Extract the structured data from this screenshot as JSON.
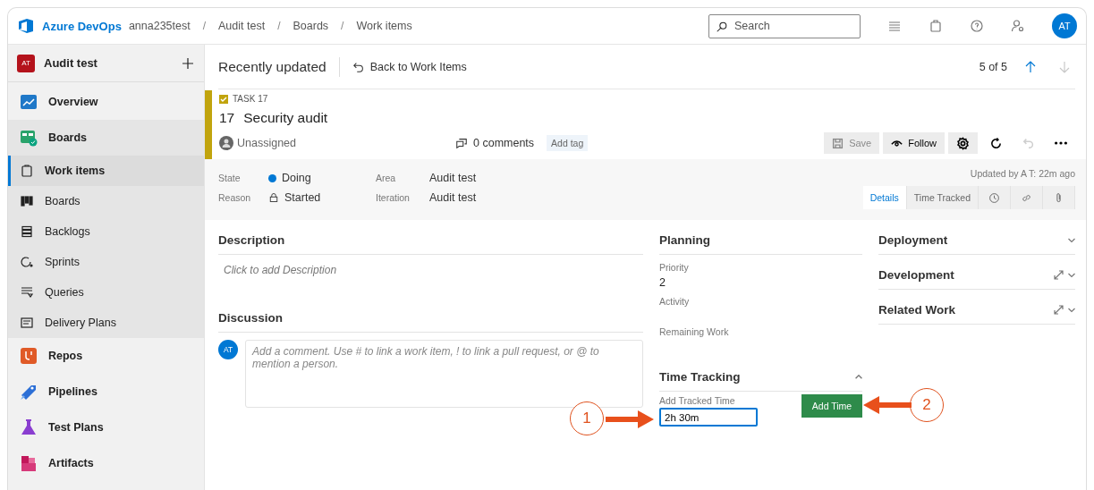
{
  "topbar": {
    "brand": "Azure DevOps",
    "breadcrumbs": [
      "anna235test",
      "Audit test",
      "Boards",
      "Work items"
    ],
    "separator": "/",
    "search": {
      "placeholder": "Search"
    },
    "icons": [
      {
        "kind": "list"
      },
      {
        "kind": "bag"
      },
      {
        "kind": "help"
      },
      {
        "kind": "user-settings"
      }
    ],
    "avatar": "AT"
  },
  "sidebar": {
    "project": {
      "badge": "AT",
      "name": "Audit test"
    },
    "items": [
      {
        "label": "Overview",
        "kind": "overview",
        "selected": false
      },
      {
        "label": "Boards",
        "kind": "boards",
        "selected": false,
        "expanded": true,
        "children": [
          {
            "label": "Work items",
            "kind": "workitems",
            "selected": true
          },
          {
            "label": "Boards",
            "kind": "board",
            "selected": false
          },
          {
            "label": "Backlogs",
            "kind": "backlogs",
            "selected": false
          },
          {
            "label": "Sprints",
            "kind": "sprints",
            "selected": false
          },
          {
            "label": "Queries",
            "kind": "queries",
            "selected": false
          },
          {
            "label": "Delivery Plans",
            "kind": "plans",
            "selected": false
          }
        ]
      },
      {
        "label": "Repos",
        "kind": "repos",
        "selected": false
      },
      {
        "label": "Pipelines",
        "kind": "pipelines",
        "selected": false
      },
      {
        "label": "Test Plans",
        "kind": "testplans",
        "selected": false
      },
      {
        "label": "Artifacts",
        "kind": "artifacts",
        "selected": false
      }
    ]
  },
  "header": {
    "title": "Recently updated",
    "back": "Back to Work Items",
    "position": "5 of 5",
    "nav": [
      {
        "kind": "up",
        "disabled": false
      },
      {
        "kind": "down",
        "disabled": true
      }
    ]
  },
  "work_item": {
    "type": "TASK 17",
    "id": "17",
    "title": "Security audit",
    "assignee": "Unassigned",
    "comments": "0 comments",
    "add_tag": "Add tag",
    "toolbar": [
      {
        "kind": "save",
        "label": "Save",
        "disabled": true
      },
      {
        "kind": "follow",
        "label": "Follow",
        "disabled": false
      },
      {
        "kind": "settings",
        "disabled": false
      },
      {
        "kind": "refresh",
        "disabled": false
      },
      {
        "kind": "undo",
        "disabled": true
      },
      {
        "kind": "more",
        "disabled": false
      }
    ]
  },
  "fields": [
    {
      "label": "State",
      "value": "Doing",
      "kind": "state",
      "color": "#0078d4"
    },
    {
      "label": "Area",
      "value": "Audit test",
      "kind": "plain"
    },
    {
      "label": "Reason",
      "value": "Started",
      "kind": "reason"
    },
    {
      "label": "Iteration",
      "value": "Audit test",
      "kind": "plain"
    }
  ],
  "updated": "Updated by A T: 22m ago",
  "tabs": [
    {
      "kind": "text",
      "label": "Details",
      "selected": true
    },
    {
      "kind": "text",
      "label": "Time Tracked",
      "selected": false
    },
    {
      "kind": "history",
      "selected": false
    },
    {
      "kind": "link",
      "selected": false
    },
    {
      "kind": "attachment",
      "selected": false
    }
  ],
  "description": {
    "heading": "Description",
    "placeholder": "Click to add Description"
  },
  "discussion": {
    "heading": "Discussion",
    "avatar": "AT",
    "placeholder": "Add a comment. Use # to link a work item, ! to link a pull request, or @ to mention a person."
  },
  "planning": {
    "heading": "Planning",
    "fields": [
      {
        "label": "Priority",
        "value": "2"
      },
      {
        "label": "Activity"
      },
      {
        "label": "Remaining Work"
      }
    ]
  },
  "time_tracking": {
    "heading": "Time Tracking",
    "expanded": true,
    "field_label": "Add Tracked Time",
    "value": "2h 30m",
    "button": "Add Time"
  },
  "sections": [
    {
      "heading": "Deployment",
      "expandable": false,
      "expanded": false
    },
    {
      "heading": "Development",
      "expandable": true,
      "expanded": false
    },
    {
      "heading": "Related Work",
      "expandable": true,
      "expanded": false
    }
  ],
  "annotations": [
    {
      "label": "1"
    },
    {
      "label": "2"
    }
  ]
}
